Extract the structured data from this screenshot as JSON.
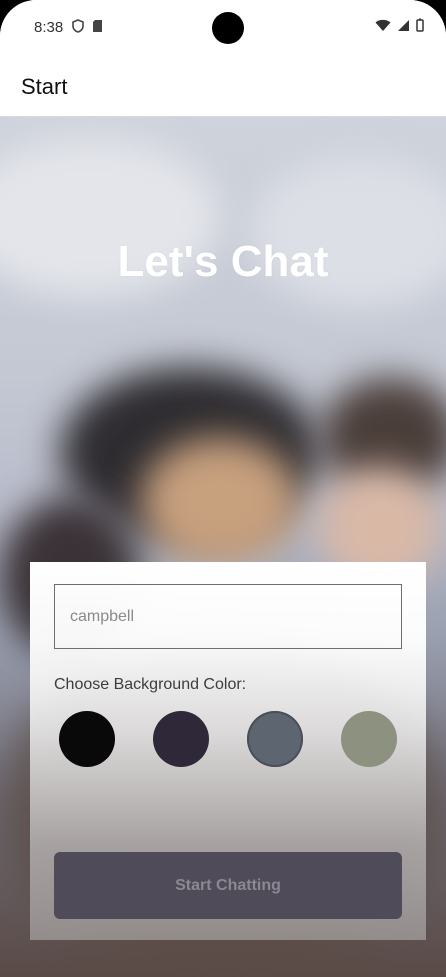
{
  "status_bar": {
    "time": "8:38",
    "left_icons": [
      "shield-icon",
      "sd-card-icon"
    ],
    "right_icons": [
      "wifi-icon",
      "signal-icon",
      "battery-icon"
    ]
  },
  "app_bar": {
    "title": "Start"
  },
  "hero": {
    "title": "Let's Chat"
  },
  "form": {
    "name_value": "campbell",
    "choose_label": "Choose Background Color:",
    "colors": [
      {
        "name": "black",
        "hex": "#090909"
      },
      {
        "name": "dark-purple",
        "hex": "#2e2838"
      },
      {
        "name": "slate",
        "hex": "#5c6570"
      },
      {
        "name": "sage",
        "hex": "#8c9180"
      }
    ],
    "start_button": "Start Chatting"
  },
  "colors": {
    "accent_button": "#4f4b58",
    "app_bar_bg": "#ffffff"
  }
}
